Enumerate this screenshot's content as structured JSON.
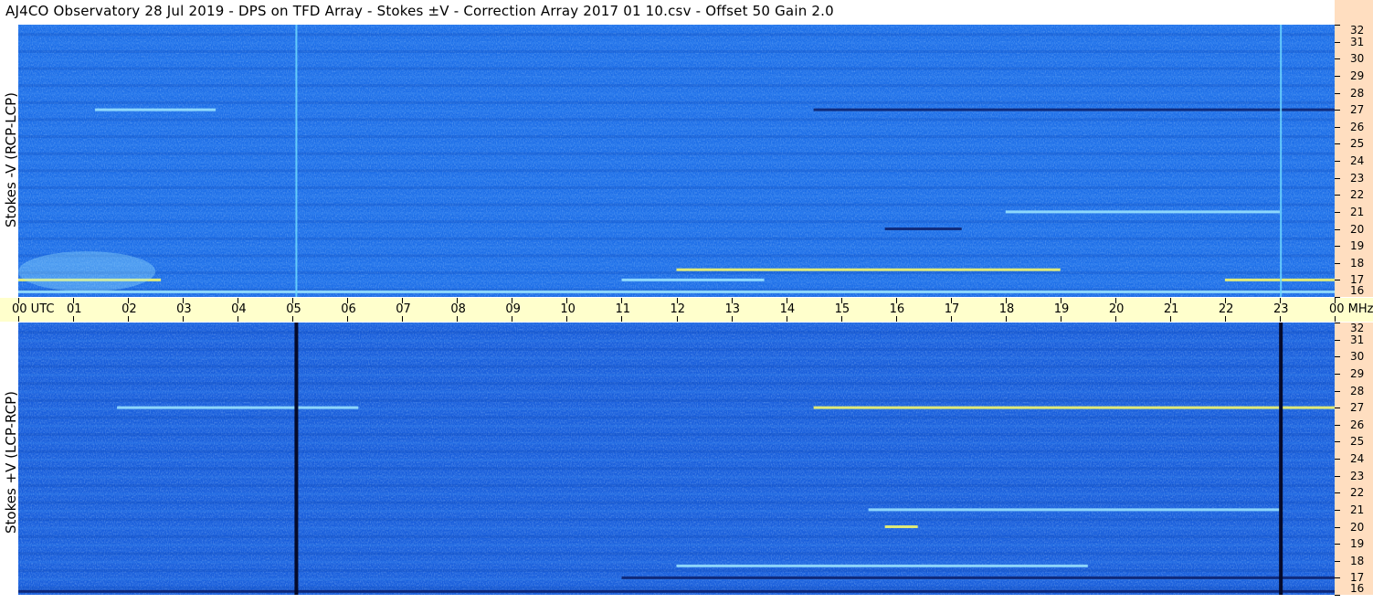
{
  "title": "AJ4CO Observatory  28 Jul 2019  -  DPS on TFD Array  -  Stokes ±V  -  Correction Array 2017 01 10.csv  -  Offset 50  Gain 2.0",
  "panels": {
    "top_ylabel": "Stokes -V (RCP-LCP)",
    "bottom_ylabel": "Stokes +V (LCP-RCP)"
  },
  "chart_data": {
    "type": "heatmap",
    "title": "AJ4CO Observatory  28 Jul 2019  -  DPS on TFD Array  -  Stokes ±V  -  Correction Array 2017 01 10.csv  -  Offset 50  Gain 2.0",
    "x_axis": {
      "unit": "UTC",
      "range": [
        0,
        24
      ],
      "ticks": [
        "00",
        "01",
        "02",
        "03",
        "04",
        "05",
        "06",
        "07",
        "08",
        "09",
        "10",
        "11",
        "12",
        "13",
        "14",
        "15",
        "16",
        "17",
        "18",
        "19",
        "20",
        "21",
        "22",
        "23",
        "00"
      ],
      "tick_hours": [
        0,
        1,
        2,
        3,
        4,
        5,
        6,
        7,
        8,
        9,
        10,
        11,
        12,
        13,
        14,
        15,
        16,
        17,
        18,
        19,
        20,
        21,
        22,
        23,
        24
      ],
      "start_label": "00  UTC",
      "end_label": "00 MHz"
    },
    "y_axis": {
      "unit": "MHz",
      "range": [
        16,
        32
      ],
      "ticks": [
        "32",
        "31",
        "30",
        "29",
        "28",
        "27",
        "26",
        "25",
        "24",
        "23",
        "22",
        "21",
        "20",
        "19",
        "18",
        "17",
        "16"
      ],
      "tick_mhz": [
        32,
        31,
        30,
        29,
        28,
        27,
        26,
        25,
        24,
        23,
        22,
        21,
        20,
        19,
        18,
        17,
        16
      ]
    },
    "colors": {
      "background_top": "#1e6fe8",
      "background_bottom": "#1a5fdc",
      "bright": "#9fe8ff",
      "hot": "#ffff66",
      "dark": "#0a1e6a",
      "axis_time_bg": "#ffffcc",
      "axis_freq_bg": "#ffdec0"
    },
    "series": [
      {
        "panel": "top",
        "ylabel": "Stokes -V (RCP-LCP)",
        "vertical_lines_utc": [
          5.07,
          23.02
        ],
        "vertical_line_style": "bright",
        "features": [
          {
            "kind": "band",
            "mhz": 17.0,
            "utc_range": [
              0.0,
              2.6
            ],
            "intensity": "hot"
          },
          {
            "kind": "band",
            "mhz": 16.3,
            "utc_range": [
              0.0,
              24.0
            ],
            "intensity": "bright"
          },
          {
            "kind": "band",
            "mhz": 17.0,
            "utc_range": [
              11.0,
              13.6
            ],
            "intensity": "bright"
          },
          {
            "kind": "band",
            "mhz": 17.6,
            "utc_range": [
              12.0,
              19.0
            ],
            "intensity": "hot"
          },
          {
            "kind": "band",
            "mhz": 17.0,
            "utc_range": [
              22.0,
              24.0
            ],
            "intensity": "hot"
          },
          {
            "kind": "band",
            "mhz": 27.0,
            "utc_range": [
              14.5,
              24.0
            ],
            "intensity": "dark"
          },
          {
            "kind": "band",
            "mhz": 27.0,
            "utc_range": [
              1.4,
              3.6
            ],
            "intensity": "bright"
          },
          {
            "kind": "band",
            "mhz": 20.0,
            "utc_range": [
              15.8,
              17.2
            ],
            "intensity": "dark"
          },
          {
            "kind": "band",
            "mhz": 21.0,
            "utc_range": [
              18.0,
              23.0
            ],
            "intensity": "bright"
          },
          {
            "kind": "glow",
            "mhz": 17.5,
            "utc_range": [
              0.0,
              2.5
            ],
            "intensity": "bright"
          }
        ]
      },
      {
        "panel": "bottom",
        "ylabel": "Stokes +V (LCP-RCP)",
        "vertical_lines_utc": [
          5.07,
          23.02
        ],
        "vertical_line_style": "dark",
        "features": [
          {
            "kind": "band",
            "mhz": 27.0,
            "utc_range": [
              14.5,
              24.0
            ],
            "intensity": "hot"
          },
          {
            "kind": "band",
            "mhz": 27.0,
            "utc_range": [
              1.8,
              6.2
            ],
            "intensity": "bright"
          },
          {
            "kind": "band",
            "mhz": 17.0,
            "utc_range": [
              11.0,
              24.0
            ],
            "intensity": "dark"
          },
          {
            "kind": "band",
            "mhz": 16.2,
            "utc_range": [
              0.0,
              24.0
            ],
            "intensity": "dark"
          },
          {
            "kind": "band",
            "mhz": 21.0,
            "utc_range": [
              15.5,
              23.0
            ],
            "intensity": "bright"
          },
          {
            "kind": "band",
            "mhz": 20.0,
            "utc_range": [
              15.8,
              16.4
            ],
            "intensity": "hot"
          },
          {
            "kind": "band",
            "mhz": 17.7,
            "utc_range": [
              12.0,
              19.5
            ],
            "intensity": "bright"
          }
        ]
      }
    ]
  }
}
